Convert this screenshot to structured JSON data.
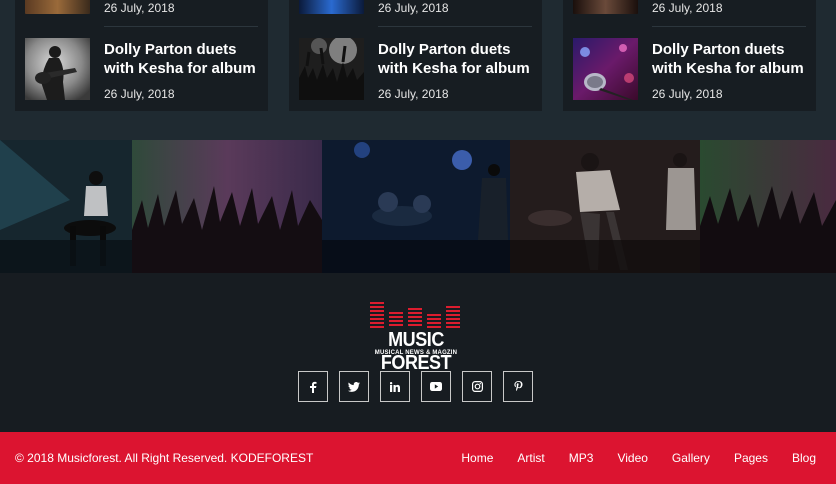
{
  "news": {
    "columns": [
      {
        "top_date": "26 July, 2018",
        "item": {
          "title": "Dolly Parton duets with Kesha for album",
          "date": "26 July, 2018",
          "thumb": "guitarist-photo"
        }
      },
      {
        "top_date": "26 July, 2018",
        "item": {
          "title": "Dolly Parton duets with Kesha for album",
          "date": "26 July, 2018",
          "thumb": "crowd-photo"
        }
      },
      {
        "top_date": "26 July, 2018",
        "item": {
          "title": "Dolly Parton duets with Kesha for album",
          "date": "26 July, 2018",
          "thumb": "microphone-photo"
        }
      }
    ]
  },
  "gallery": [
    "drummer-photo",
    "concert-crowd-photo",
    "stage-band-photo",
    "singer-photo",
    "guitar-crowd-photo"
  ],
  "footer": {
    "logo": {
      "name": "MUSIC FOREST",
      "tagline": "MUSICAL NEWS & MAGZIN"
    },
    "socials": [
      "facebook-icon",
      "twitter-icon",
      "linkedin-icon",
      "youtube-icon",
      "instagram-icon",
      "pinterest-icon"
    ]
  },
  "bottom_bar": {
    "copyright": "© 2018 Musicforest. All Right Reserved. KODEFOREST",
    "nav": [
      "Home",
      "Artist",
      "MP3",
      "Video",
      "Gallery",
      "Pages",
      "Blog"
    ]
  },
  "colors": {
    "accent": "#dc1430",
    "page_bg": "#171c21",
    "news_bg": "#1f2a31",
    "card_bg": "#171d22"
  }
}
